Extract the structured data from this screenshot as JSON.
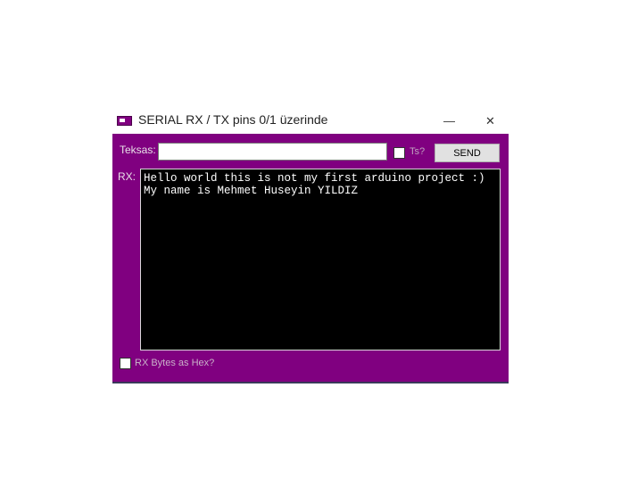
{
  "window": {
    "title": "SERIAL RX / TX pins 0/1 üzerinde",
    "minimize_glyph": "—",
    "close_glyph": "✕"
  },
  "tx": {
    "label": "Teksas:",
    "value": "",
    "placeholder": "",
    "timestamp_label": "Ts?",
    "send_label": "SEND"
  },
  "rx": {
    "label": "RX:",
    "lines": [
      "Hello world this is not my first arduino project :)",
      "My name is Mehmet Huseyin YILDIZ"
    ],
    "hex_label": "RX Bytes as Hex?"
  },
  "colors": {
    "window_background": "#800080",
    "rx_background": "#000000",
    "rx_text": "#ffffff"
  }
}
